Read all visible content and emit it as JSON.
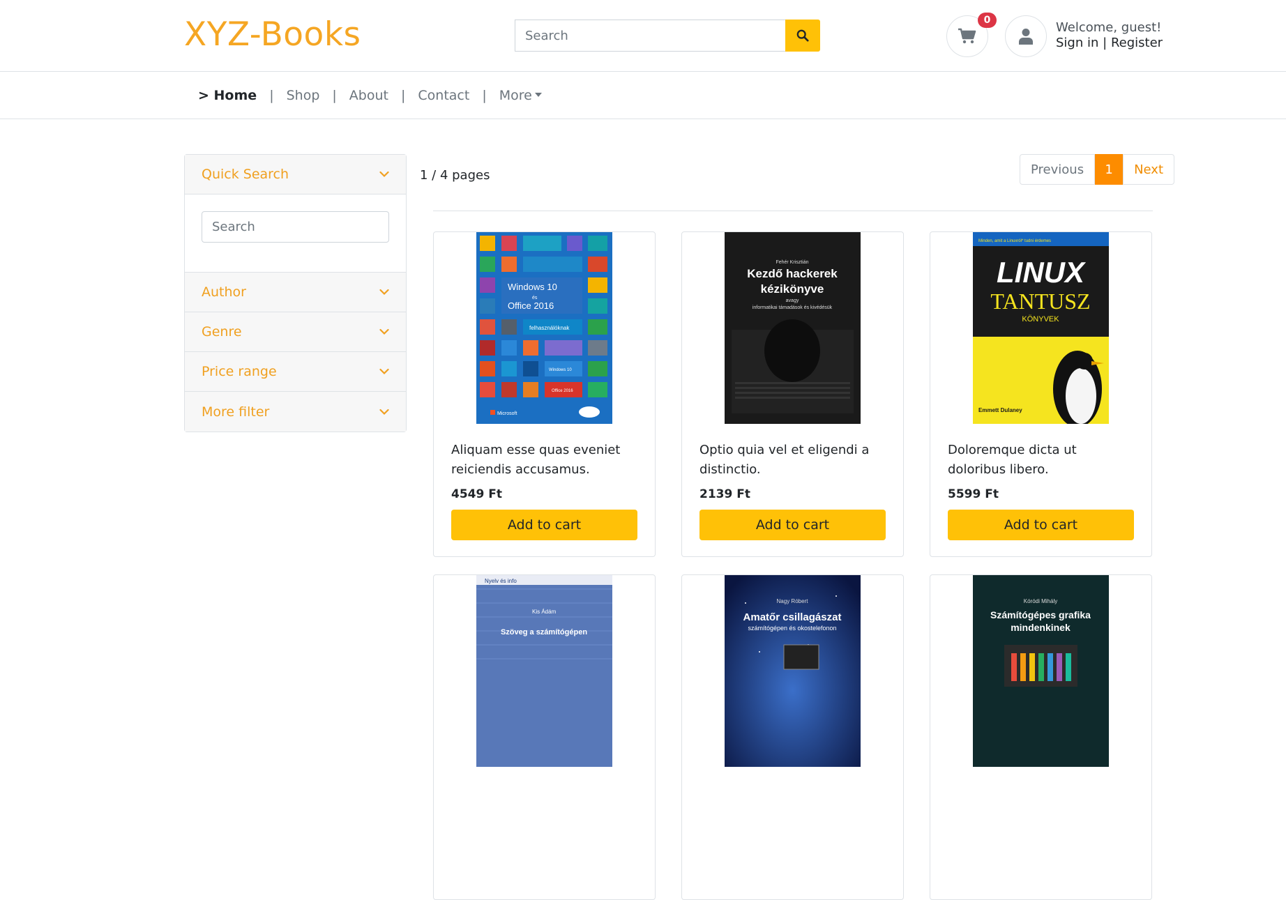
{
  "header": {
    "brand": "XYZ-Books",
    "search_placeholder": "Search",
    "cart_count": "0",
    "welcome": "Welcome, guest!",
    "signin": "Sign in",
    "separator": "|",
    "register": "Register"
  },
  "nav": {
    "home": "> Home",
    "shop": "Shop",
    "about": "About",
    "contact": "Contact",
    "more": "More",
    "sep": "|"
  },
  "sidebar": {
    "quick_search": "Quick Search",
    "search_placeholder": "Search",
    "author": "Author",
    "genre": "Genre",
    "price_range": "Price range",
    "more_filter": "More filter"
  },
  "pagination": {
    "summary": "1 / 4 pages",
    "previous": "Previous",
    "current": "1",
    "next": "Next"
  },
  "products": [
    {
      "title": "Aliquam esse quas eveniet reiciendis accusamus.",
      "price": "4549 Ft",
      "button": "Add to cart"
    },
    {
      "title": "Optio quia vel et eligendi a distinctio.",
      "price": "2139 Ft",
      "button": "Add to cart"
    },
    {
      "title": "Doloremque dicta ut doloribus libero.",
      "price": "5599 Ft",
      "button": "Add to cart"
    },
    {
      "title": "",
      "price": "",
      "button": ""
    },
    {
      "title": "",
      "price": "",
      "button": ""
    },
    {
      "title": "",
      "price": "",
      "button": ""
    }
  ],
  "covers": [
    {
      "top": "",
      "title1": "Windows 10",
      "mid": "és",
      "title2": "Office 2016",
      "sub": "felhasználóknak",
      "badge1": "Windows 10",
      "badge2": "Office 2016",
      "publisher": "Microsoft"
    },
    {
      "author": "Fehér Krisztián",
      "title1": "Kezdő hackerek",
      "title2": "kézikönyve",
      "sub1": "avagy",
      "sub2": "informatikai támadások és kivédésük"
    },
    {
      "top": "Minden, amit a Linuxról* tudni érdemes",
      "title1": "LINUX",
      "title2": "TANTUSZ",
      "sub": "KÖNYVEK",
      "author": "Emmett Dulaney"
    },
    {
      "series": "Nyelv és info",
      "author": "Kis Ádám",
      "title": "Szöveg a számítógépen"
    },
    {
      "author": "Nagy Róbert",
      "title1": "Amatőr csillagászat",
      "title2": "számítógépen és okostelefonon"
    },
    {
      "author": "Kóródi Mihály",
      "title1": "Számítógépes grafika",
      "title2": "mindenkinek"
    }
  ],
  "colors": {
    "brand": "#f5a623",
    "accent": "#ffc107",
    "badge": "#dc3545",
    "page_active": "#fd8c00"
  }
}
